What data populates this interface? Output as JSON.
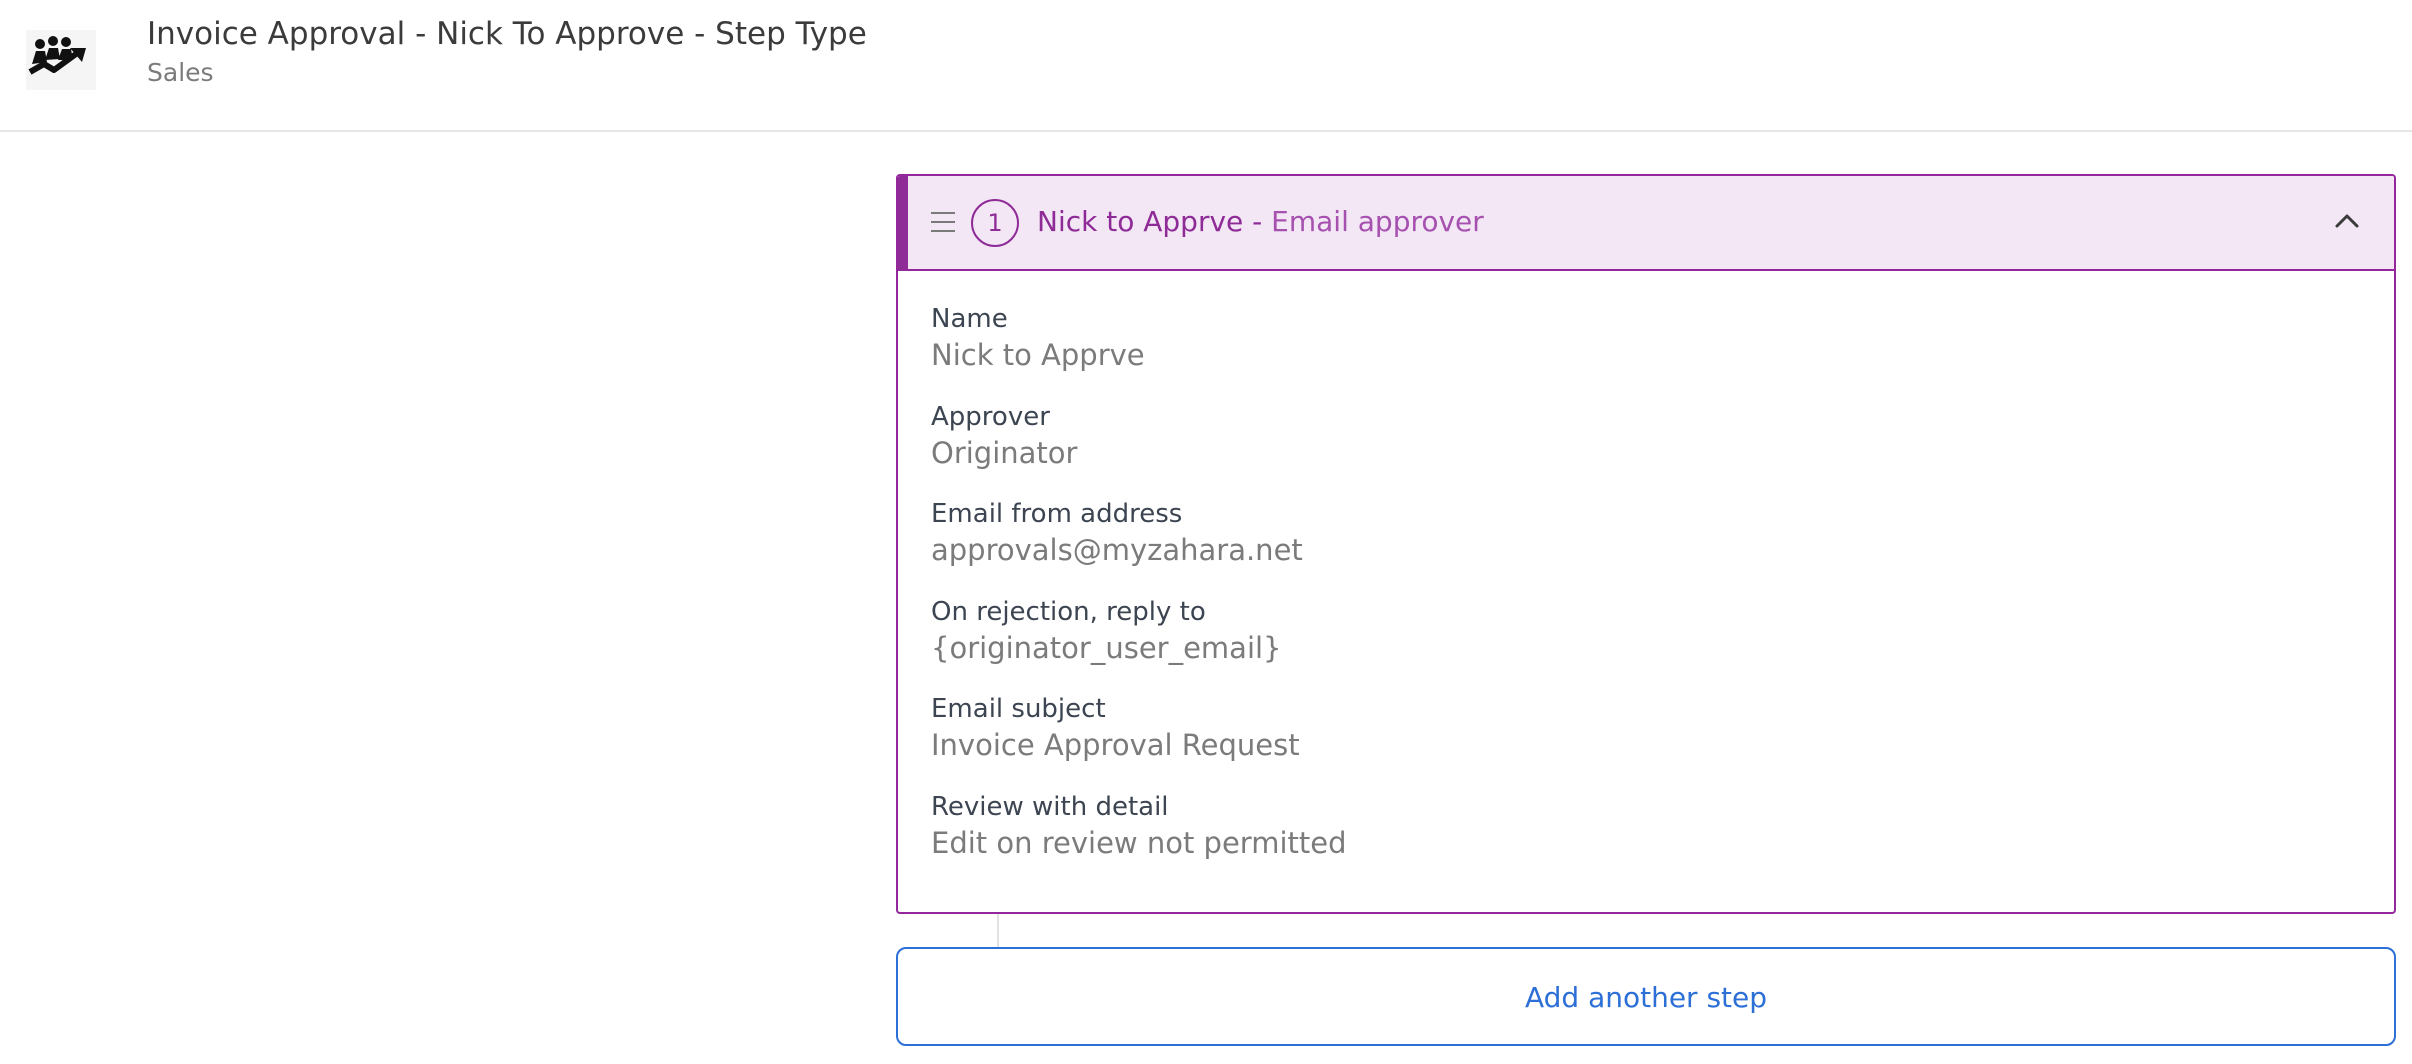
{
  "header": {
    "logo_icon": "team-chart-logo-icon",
    "title": "Invoice Approval - Nick To Approve - Step Type",
    "subtitle": "Sales"
  },
  "step": {
    "number": "1",
    "name": "Nick to Apprve",
    "separator": " - ",
    "type": "Email approver",
    "drag_icon": "drag-handle-icon",
    "collapse_icon": "chevron-up-icon",
    "fields": [
      {
        "label": "Name",
        "value": "Nick to Apprve"
      },
      {
        "label": "Approver",
        "value": "Originator"
      },
      {
        "label": "Email from address",
        "value": "approvals@myzahara.net"
      },
      {
        "label": "On rejection, reply to",
        "value": "{originator_user_email}"
      },
      {
        "label": "Email subject",
        "value": "Invoice Approval Request"
      },
      {
        "label": "Review with detail",
        "value": "Edit on review not permitted"
      }
    ]
  },
  "actions": {
    "add_step_label": "Add another step"
  },
  "colors": {
    "accent_purple": "#8e2b97",
    "header_tint": "#f3e6f5",
    "link_blue": "#2c6fd6"
  }
}
